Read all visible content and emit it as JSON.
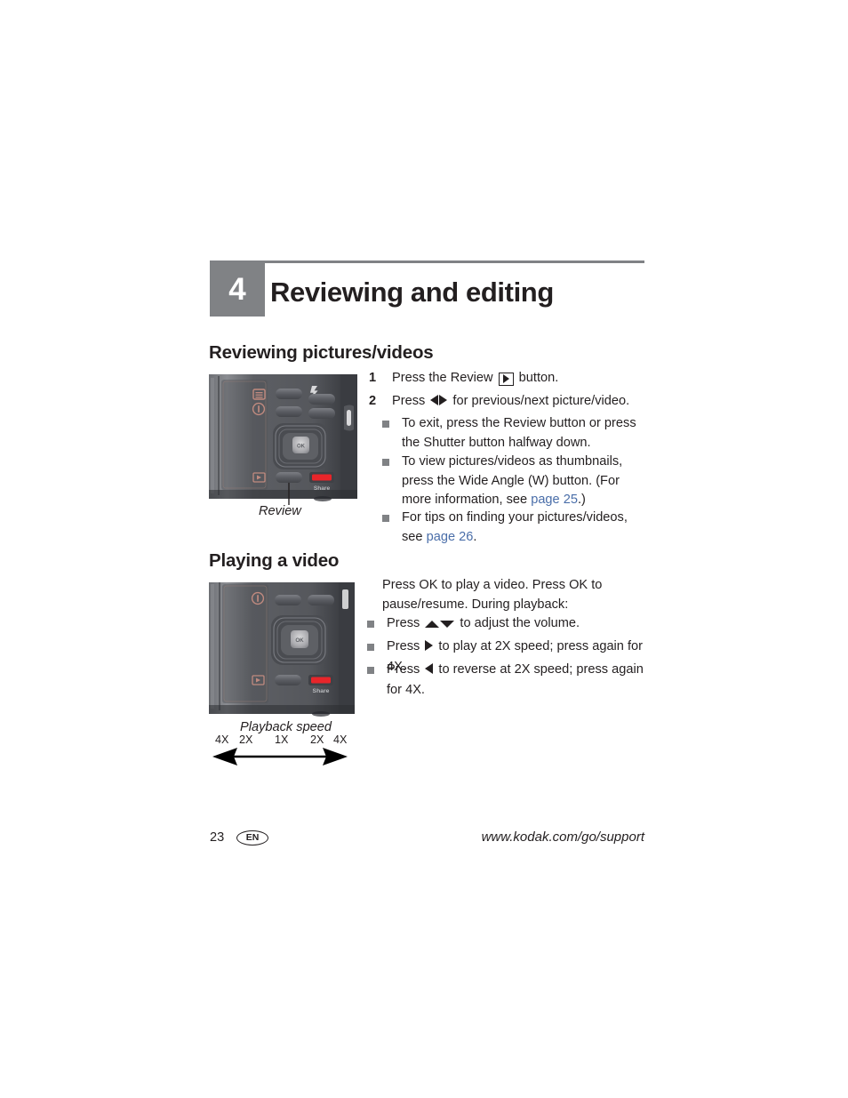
{
  "chapter": {
    "number": "4",
    "title": "Reviewing and editing"
  },
  "sections": {
    "reviewing": {
      "heading": "Reviewing pictures/videos",
      "steps": [
        {
          "num": "1",
          "pre": "Press the Review ",
          "icon": "play-button-icon",
          "post": " button."
        },
        {
          "num": "2",
          "pre": "Press ",
          "icon": "left-right-arrows-icon",
          "post": " for previous/next picture/video."
        }
      ],
      "bullets": [
        {
          "text": "To exit, press the Review button or press the Shutter button halfway down."
        },
        {
          "pre": "To view pictures/videos as thumbnails, press the Wide Angle (W) button. (For more information, see ",
          "link": "page 25",
          "post": ".)"
        },
        {
          "pre": "For tips on finding your pictures/videos, see ",
          "link": "page 26",
          "post": "."
        }
      ],
      "figure_caption": "Review"
    },
    "playing": {
      "heading": "Playing a video",
      "intro": "Press OK to play a video. Press OK to pause/resume. During playback:",
      "bullets": [
        {
          "pre": "Press ",
          "icon": "up-down-arrows-icon",
          "post": " to adjust the volume."
        },
        {
          "pre": "Press ",
          "icon": "right-arrow-icon",
          "post": " to play at 2X speed; press again for 4X."
        },
        {
          "pre": "Press ",
          "icon": "left-arrow-icon",
          "post": " to reverse at 2X speed; press again for 4X."
        }
      ],
      "figure_caption": "Playback speed",
      "speed_labels": [
        "4X",
        "2X",
        "1X",
        "2X",
        "4X"
      ]
    }
  },
  "camera": {
    "share_label": "Share",
    "icons": [
      "menu-icon",
      "info-icon",
      "flash-icon",
      "review-icon",
      "ok-button",
      "share-button"
    ],
    "ok_label": "OK"
  },
  "footer": {
    "page_number": "23",
    "language": "EN",
    "url": "www.kodak.com/go/support"
  },
  "colors": {
    "chapter_block": "#808285",
    "link": "#4a6ea9",
    "text": "#231f20",
    "share_red": "#e8252a"
  }
}
